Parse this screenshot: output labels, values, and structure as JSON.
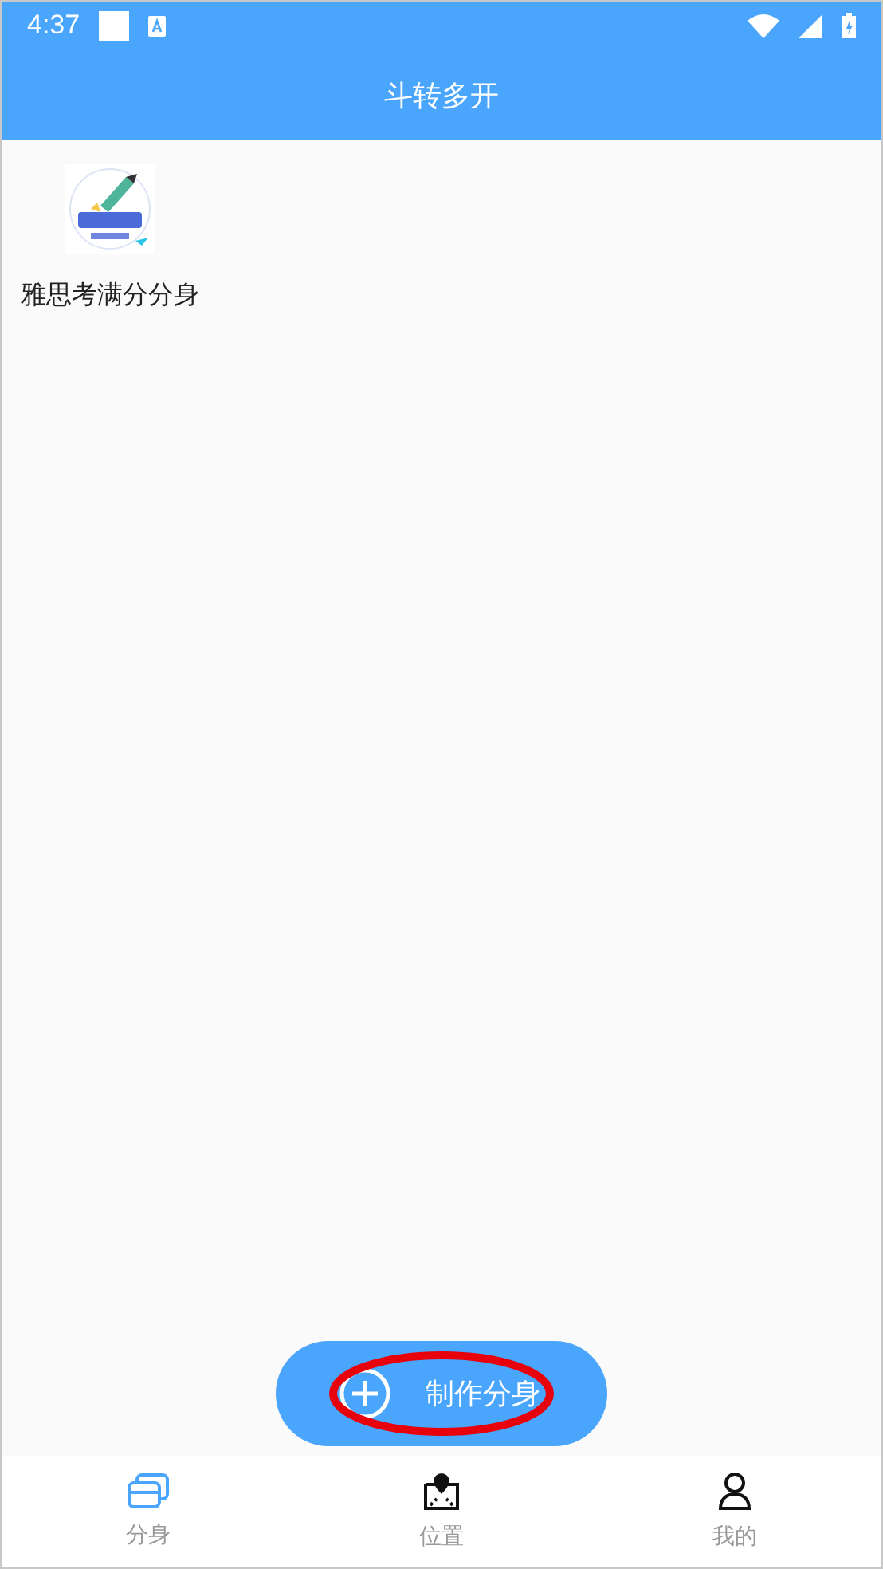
{
  "status_bar": {
    "time": "4:37"
  },
  "toolbar": {
    "title": "斗转多开"
  },
  "apps": [
    {
      "label": "雅思考满分分身"
    }
  ],
  "fab": {
    "label": "制作分身",
    "highlighted": true
  },
  "bottom_nav": [
    {
      "kind": "clones",
      "label": "分身",
      "selected": true
    },
    {
      "kind": "location",
      "label": "位置",
      "selected": false
    },
    {
      "kind": "profile",
      "label": "我的",
      "selected": false
    }
  ]
}
